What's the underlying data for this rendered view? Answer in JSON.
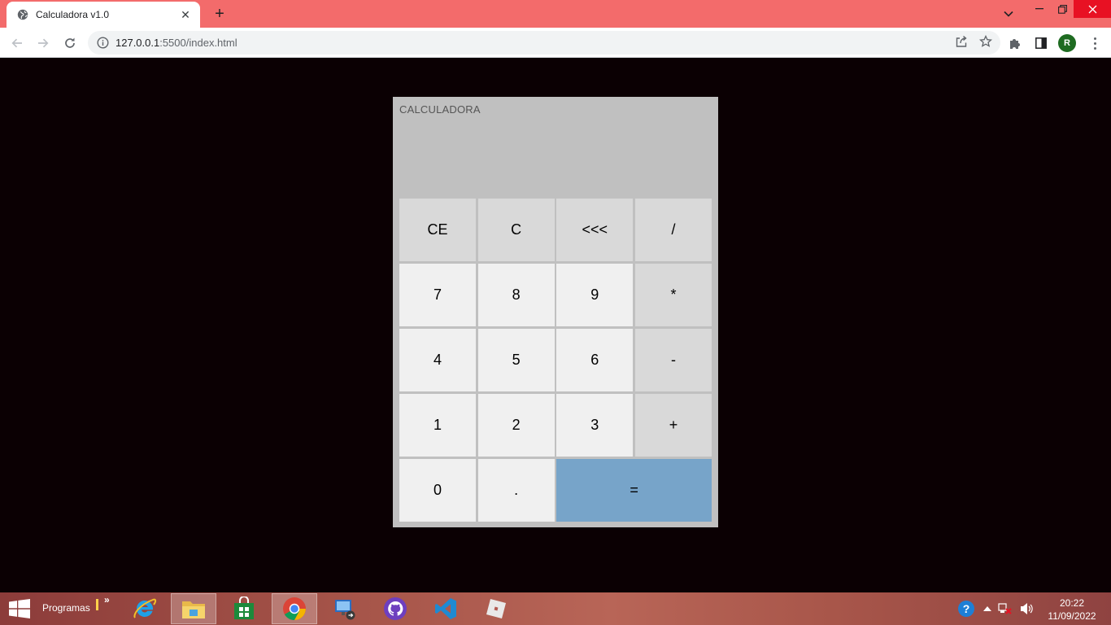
{
  "browser": {
    "tab_title": "Calculadora v1.0",
    "url_host": "127.0.0.1",
    "url_rest": ":5500/index.html",
    "profile_initial": "R"
  },
  "calculator": {
    "title": "CALCULADORA",
    "display_value": "",
    "keys": [
      {
        "label": "CE",
        "kind": "fn"
      },
      {
        "label": "C",
        "kind": "fn"
      },
      {
        "label": "<<<",
        "kind": "fn"
      },
      {
        "label": "/",
        "kind": "fn"
      },
      {
        "label": "7",
        "kind": "num"
      },
      {
        "label": "8",
        "kind": "num"
      },
      {
        "label": "9",
        "kind": "num"
      },
      {
        "label": "*",
        "kind": "fn"
      },
      {
        "label": "4",
        "kind": "num"
      },
      {
        "label": "5",
        "kind": "num"
      },
      {
        "label": "6",
        "kind": "num"
      },
      {
        "label": "-",
        "kind": "fn"
      },
      {
        "label": "1",
        "kind": "num"
      },
      {
        "label": "2",
        "kind": "num"
      },
      {
        "label": "3",
        "kind": "num"
      },
      {
        "label": "+",
        "kind": "fn"
      },
      {
        "label": "0",
        "kind": "num"
      },
      {
        "label": ".",
        "kind": "num"
      },
      {
        "label": "=",
        "kind": "eq"
      }
    ]
  },
  "taskbar": {
    "toolbar_label": "Programas",
    "overflow_chevron": "»",
    "time": "20:22",
    "date": "11/09/2022"
  },
  "colors": {
    "tabstrip": "#f36b6b",
    "page_background": "#0b0003",
    "calc_body": "#c0c0c0",
    "key_number": "#f0f0f0",
    "key_function": "#d9d9d9",
    "key_equals": "#77a4c9"
  }
}
